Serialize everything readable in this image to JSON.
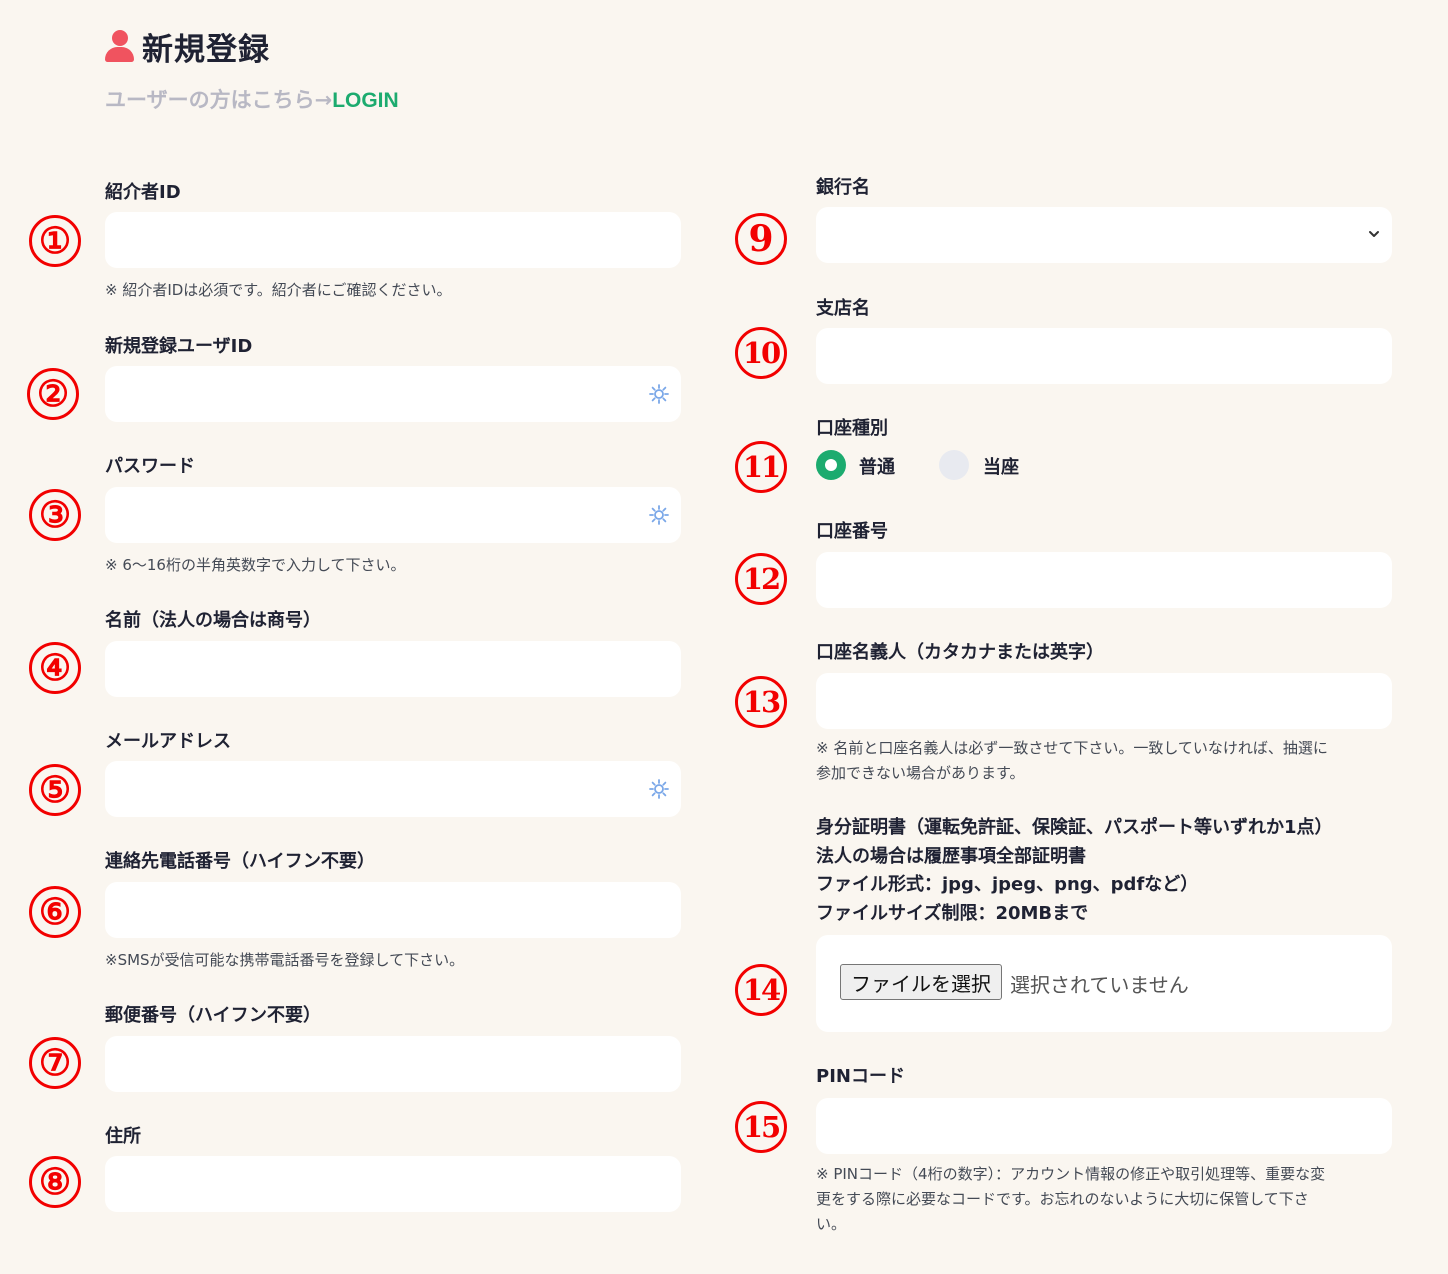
{
  "header": {
    "title": "新規登録",
    "subtitle": "ユーザーの方はこちら→",
    "login_link": "LOGIN"
  },
  "markers": [
    "①",
    "②",
    "③",
    "④",
    "⑤",
    "⑥",
    "⑦",
    "⑧",
    "9",
    "10",
    "11",
    "12",
    "13",
    "14",
    "15"
  ],
  "left_fields": {
    "referrer_id": {
      "label": "紹介者ID",
      "note": "※ 紹介者IDは必須です。紹介者にご確認ください。"
    },
    "user_id": {
      "label": "新規登録ユーザID"
    },
    "password": {
      "label": "パスワード",
      "note": "※ 6〜16桁の半角英数字で入力して下さい。"
    },
    "name": {
      "label": "名前（法人の場合は商号）"
    },
    "email": {
      "label": "メールアドレス"
    },
    "phone": {
      "label": "連絡先電話番号（ハイフン不要）",
      "note": "※SMSが受信可能な携帯電話番号を登録して下さい。"
    },
    "postal": {
      "label": "郵便番号（ハイフン不要）"
    },
    "address": {
      "label": "住所"
    }
  },
  "right_fields": {
    "bank_name": {
      "label": "銀行名",
      "selected": ""
    },
    "branch_name": {
      "label": "支店名"
    },
    "account_type": {
      "label": "口座種別",
      "options": [
        {
          "label": "普通",
          "checked": true
        },
        {
          "label": "当座",
          "checked": false
        }
      ]
    },
    "account_number": {
      "label": "口座番号"
    },
    "account_holder": {
      "label": "口座名義人（カタカナまたは英字）",
      "note_line1": "※ 名前と口座名義人は必ず一致させて下さい。一致していなければ、抽選に",
      "note_line2": "参加できない場合があります。"
    },
    "id_document": {
      "line1": "身分証明書（運転免許証、保険証、パスポート等いずれか1点）",
      "line2": "法人の場合は履歴事項全部証明書",
      "line3": "ファイル形式：jpg、jpeg、png、pdfなど）",
      "line4": "ファイルサイズ制限：20MBまで",
      "button": "ファイルを選択",
      "status": "選択されていません"
    },
    "pin": {
      "label": "PINコード",
      "note_line1": "※ PINコード（4桁の数字）：アカウント情報の修正や取引処理等、重要な変",
      "note_line2": "更をする際に必要なコードです。お忘れのないように大切に保管して下さ",
      "note_line3": "い。"
    }
  },
  "colors": {
    "background": "#faf6f0",
    "accent_green": "#1cab6f",
    "marker_red": "#f20000",
    "icon_red": "#f0535f"
  }
}
